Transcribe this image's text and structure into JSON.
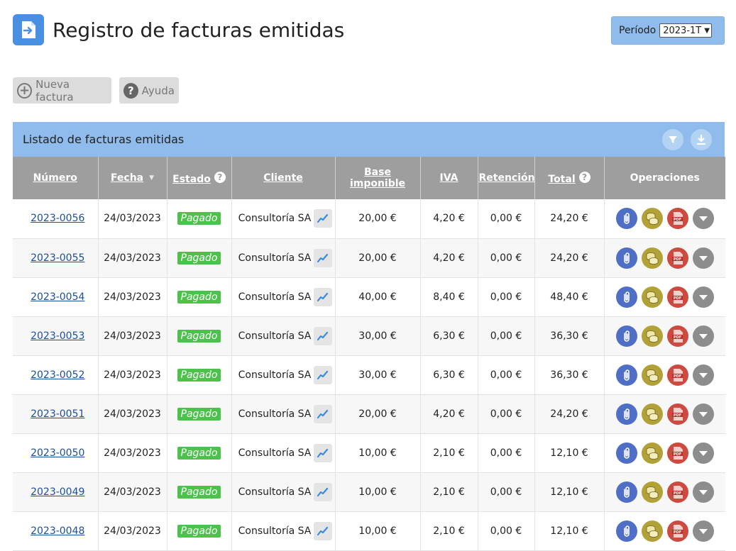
{
  "header": {
    "title": "Registro de facturas emitidas",
    "period_label": "Período",
    "period_value": "2023-1T"
  },
  "toolbar": {
    "new_invoice": "Nueva factura",
    "help": "Ayuda"
  },
  "panel": {
    "title": "Listado de facturas emitidas"
  },
  "columns": {
    "numero": "Número",
    "fecha": "Fecha",
    "estado": "Estado",
    "cliente": "Cliente",
    "base": "Base imponible",
    "iva": "IVA",
    "retencion": "Retención",
    "total": "Total",
    "operaciones": "Operaciones"
  },
  "rows": [
    {
      "numero": "2023-0056",
      "fecha": "24/03/2023",
      "estado": "Pagado",
      "cliente": "Consultoría SA",
      "base": "20,00 €",
      "iva": "4,20 €",
      "retencion": "0,00 €",
      "total": "24,20 €"
    },
    {
      "numero": "2023-0055",
      "fecha": "24/03/2023",
      "estado": "Pagado",
      "cliente": "Consultoría SA",
      "base": "20,00 €",
      "iva": "4,20 €",
      "retencion": "0,00 €",
      "total": "24,20 €"
    },
    {
      "numero": "2023-0054",
      "fecha": "24/03/2023",
      "estado": "Pagado",
      "cliente": "Consultoría SA",
      "base": "40,00 €",
      "iva": "8,40 €",
      "retencion": "0,00 €",
      "total": "48,40 €"
    },
    {
      "numero": "2023-0053",
      "fecha": "24/03/2023",
      "estado": "Pagado",
      "cliente": "Consultoría SA",
      "base": "30,00 €",
      "iva": "6,30 €",
      "retencion": "0,00 €",
      "total": "36,30 €"
    },
    {
      "numero": "2023-0052",
      "fecha": "24/03/2023",
      "estado": "Pagado",
      "cliente": "Consultoría SA",
      "base": "30,00 €",
      "iva": "6,30 €",
      "retencion": "0,00 €",
      "total": "36,30 €"
    },
    {
      "numero": "2023-0051",
      "fecha": "24/03/2023",
      "estado": "Pagado",
      "cliente": "Consultoría SA",
      "base": "20,00 €",
      "iva": "4,20 €",
      "retencion": "0,00 €",
      "total": "24,20 €"
    },
    {
      "numero": "2023-0050",
      "fecha": "24/03/2023",
      "estado": "Pagado",
      "cliente": "Consultoría SA",
      "base": "10,00 €",
      "iva": "2,10 €",
      "retencion": "0,00 €",
      "total": "12,10 €"
    },
    {
      "numero": "2023-0049",
      "fecha": "24/03/2023",
      "estado": "Pagado",
      "cliente": "Consultoría SA",
      "base": "10,00 €",
      "iva": "2,10 €",
      "retencion": "0,00 €",
      "total": "12,10 €"
    },
    {
      "numero": "2023-0048",
      "fecha": "24/03/2023",
      "estado": "Pagado",
      "cliente": "Consultoría SA",
      "base": "10,00 €",
      "iva": "2,10 €",
      "retencion": "0,00 €",
      "total": "12,10 €"
    }
  ],
  "icons": {
    "app": "invoice-arrow-icon",
    "add": "plus-circle-icon",
    "help": "question-circle-icon",
    "filter": "filter-icon",
    "download": "download-icon",
    "chart": "chart-line-icon",
    "attach": "paperclip-icon",
    "payments": "coins-icon",
    "pdf": "pdf-icon",
    "more": "chevron-down-icon"
  },
  "colors": {
    "accent": "#4a90e2",
    "panel_header": "#8fbcec",
    "table_header": "#9e9e9e",
    "paid": "#4cc24c",
    "link": "#1a4f9c"
  }
}
